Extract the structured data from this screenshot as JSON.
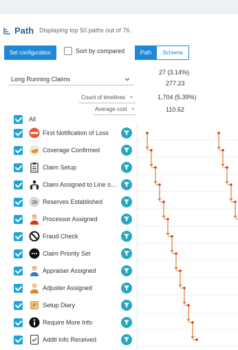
{
  "header": {
    "title": "Path",
    "subtitle": "Displaying top 50 paths out of 76."
  },
  "toolbar": {
    "set_configuration": "Set configuration",
    "sort_label": "Sort by compared",
    "tab_path": "Path",
    "tab_schema": "Schema"
  },
  "dropdown": {
    "value": "Long Running Claims"
  },
  "stats": {
    "top1": "27 (3.14%)",
    "top2": "277.23",
    "count_label": "Count of timelines",
    "count_value": "1,704 (5.39%)",
    "avg_label": "Average cost",
    "avg_value": "110.62"
  },
  "steps": {
    "all": "All",
    "items": [
      {
        "label": "First Notification of Loss",
        "icon": "fnol-icon"
      },
      {
        "label": "Coverage Confirmed",
        "icon": "hand-icon"
      },
      {
        "label": "Claim Setup",
        "icon": "clipboard-icon"
      },
      {
        "label": "Claim Assigned to Line o...",
        "icon": "org-chart-icon"
      },
      {
        "label": "Reserves Established",
        "icon": "reserves-badge-icon",
        "badge": "28"
      },
      {
        "label": "Processor Assigned",
        "icon": "person-red-icon"
      },
      {
        "label": "Fraud Check",
        "icon": "no-entry-icon"
      },
      {
        "label": "Claim Priority Set",
        "icon": "priority-dots-icon"
      },
      {
        "label": "Appraiser Assigned",
        "icon": "person-blue-icon"
      },
      {
        "label": "Adjuster Assigned",
        "icon": "person-orange-icon"
      },
      {
        "label": "Setup Diary",
        "icon": "diary-icon"
      },
      {
        "label": "Require More Info",
        "icon": "info-icon"
      },
      {
        "label": "Addtl Info Received",
        "icon": "received-doc-icon"
      }
    ]
  },
  "colors": {
    "accent": "#1f88d8",
    "checkbox": "#22a3d6",
    "funnel": "#25a7c2",
    "path_line": "#e07a2e",
    "path_node": "#d9351e"
  },
  "path_columns": [
    {
      "steps": [
        0,
        1,
        2,
        3,
        4,
        5,
        6,
        7,
        8,
        9,
        10,
        11,
        12
      ]
    },
    {
      "steps": [
        0,
        1,
        2,
        3,
        4,
        5
      ]
    }
  ]
}
